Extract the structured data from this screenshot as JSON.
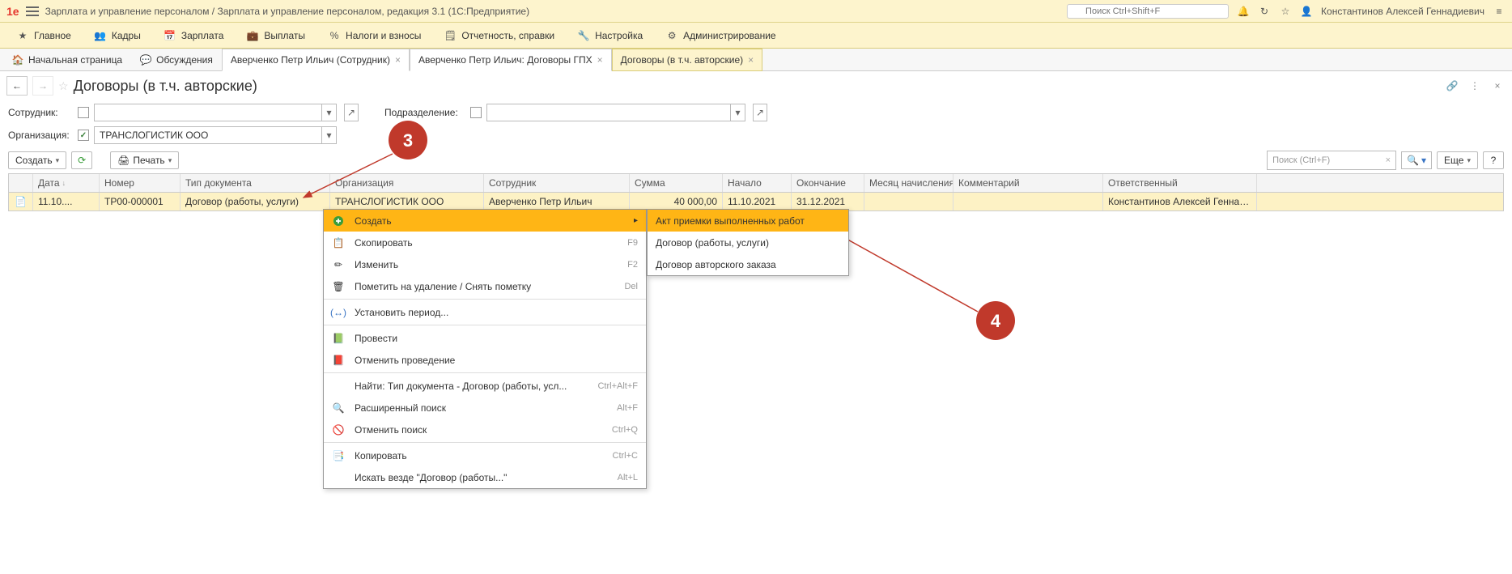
{
  "titlebar": {
    "text": "Зарплата и управление персоналом / Зарплата и управление персоналом, редакция 3.1  (1С:Предприятие)",
    "search_placeholder": "Поиск Ctrl+Shift+F",
    "user": "Константинов Алексей Геннадиевич"
  },
  "menu": [
    {
      "icon": "star",
      "label": "Главное"
    },
    {
      "icon": "people",
      "label": "Кадры"
    },
    {
      "icon": "calendar",
      "label": "Зарплата"
    },
    {
      "icon": "wallet",
      "label": "Выплаты"
    },
    {
      "icon": "percent",
      "label": "Налоги и взносы"
    },
    {
      "icon": "report",
      "label": "Отчетность, справки"
    },
    {
      "icon": "wrench",
      "label": "Настройка"
    },
    {
      "icon": "gear",
      "label": "Администрирование"
    }
  ],
  "tabs": [
    {
      "icon": "home",
      "label": "Начальная страница",
      "closable": false
    },
    {
      "icon": "chat",
      "label": "Обсуждения",
      "closable": false
    },
    {
      "label": "Аверченко Петр Ильич (Сотрудник)",
      "closable": true
    },
    {
      "label": "Аверченко Петр Ильич: Договоры ГПХ",
      "closable": true
    },
    {
      "label": "Договоры (в т.ч. авторские)",
      "closable": true,
      "active": true
    }
  ],
  "page": {
    "title": "Договоры (в т.ч. авторские)",
    "filter_employee_label": "Сотрудник:",
    "filter_subdiv_label": "Подразделение:",
    "filter_org_label": "Организация:",
    "org_value": "ТРАНСЛОГИСТИК ООО",
    "create_btn": "Создать",
    "print_btn": "Печать",
    "search_placeholder": "Поиск (Ctrl+F)",
    "more_btn": "Еще"
  },
  "table": {
    "columns": {
      "date": "Дата",
      "num": "Номер",
      "type": "Тип документа",
      "org": "Организация",
      "emp": "Сотрудник",
      "sum": "Сумма",
      "start": "Начало",
      "end": "Окончание",
      "month": "Месяц начисления",
      "comment": "Комментарий",
      "resp": "Ответственный"
    },
    "rows": [
      {
        "date": "11.10....",
        "num": "ТР00-000001",
        "type": "Договор (работы, услуги)",
        "org": "ТРАНСЛОГИСТИК ООО",
        "emp": "Аверченко Петр Ильич",
        "sum": "40 000,00",
        "start": "11.10.2021",
        "end": "31.12.2021",
        "month": "",
        "comment": "",
        "resp": "Константинов Алексей Геннади..."
      }
    ]
  },
  "context": {
    "items": [
      {
        "icon": "plus",
        "label": "Создать",
        "arrow": true,
        "hover": true
      },
      {
        "icon": "copy",
        "label": "Скопировать",
        "key": "F9"
      },
      {
        "icon": "pencil",
        "label": "Изменить",
        "key": "F2"
      },
      {
        "icon": "mark",
        "label": "Пометить на удаление / Снять пометку",
        "key": "Del"
      },
      {
        "sep": true
      },
      {
        "icon": "period",
        "label": "Установить период..."
      },
      {
        "sep": true
      },
      {
        "icon": "conduct",
        "label": "Провести"
      },
      {
        "icon": "cancel-conduct",
        "label": "Отменить проведение"
      },
      {
        "sep": true
      },
      {
        "icon": "",
        "label": "Найти: Тип документа - Договор (работы, усл...",
        "key": "Ctrl+Alt+F"
      },
      {
        "icon": "find",
        "label": "Расширенный поиск",
        "key": "Alt+F"
      },
      {
        "icon": "cancel-find",
        "label": "Отменить поиск",
        "key": "Ctrl+Q"
      },
      {
        "sep": true
      },
      {
        "icon": "copyall",
        "label": "Копировать",
        "key": "Ctrl+C"
      },
      {
        "icon": "",
        "label": "Искать везде \"Договор (работы...\"",
        "key": "Alt+L"
      }
    ],
    "sub": [
      {
        "label": "Акт приемки выполненных работ",
        "hover": true
      },
      {
        "label": "Договор (работы, услуги)"
      },
      {
        "label": "Договор авторского заказа"
      }
    ]
  },
  "callouts": {
    "c3": "3",
    "c4": "4"
  }
}
